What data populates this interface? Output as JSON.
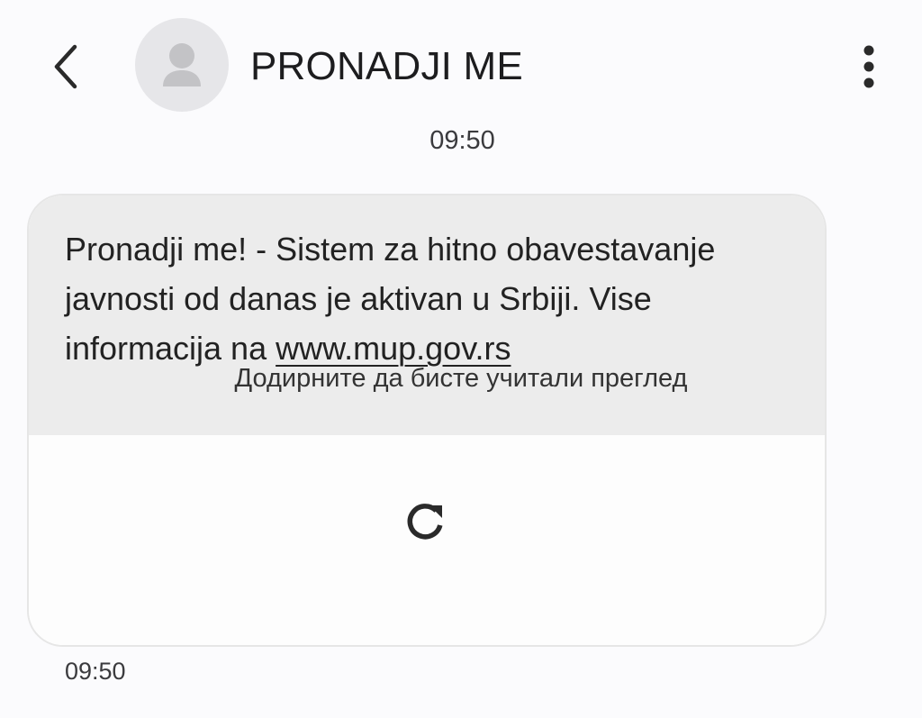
{
  "header": {
    "back_icon": "chevron-left-icon",
    "avatar_icon": "person-icon",
    "contact_name": "PRONADJI ME",
    "menu_icon": "more-vert-icon"
  },
  "conversation": {
    "date_stamp": "09:50",
    "messages": [
      {
        "text": "Pronadji me! -  Sistem za hitno obavestavanje javnosti od danas je aktivan u Srbiji. Vise informacija na ",
        "link_text": "www.mup.gov.rs",
        "preview": {
          "icon": "refresh-icon",
          "label": "Додирните да бисте учитали преглед"
        },
        "time": "09:50"
      }
    ]
  },
  "colors": {
    "page_background": "#fbfbfd",
    "bubble_background": "#ececec",
    "avatar_background": "#e6e6e9",
    "avatar_glyph": "#c3c3c6",
    "icon_color": "#2a2a2a"
  }
}
